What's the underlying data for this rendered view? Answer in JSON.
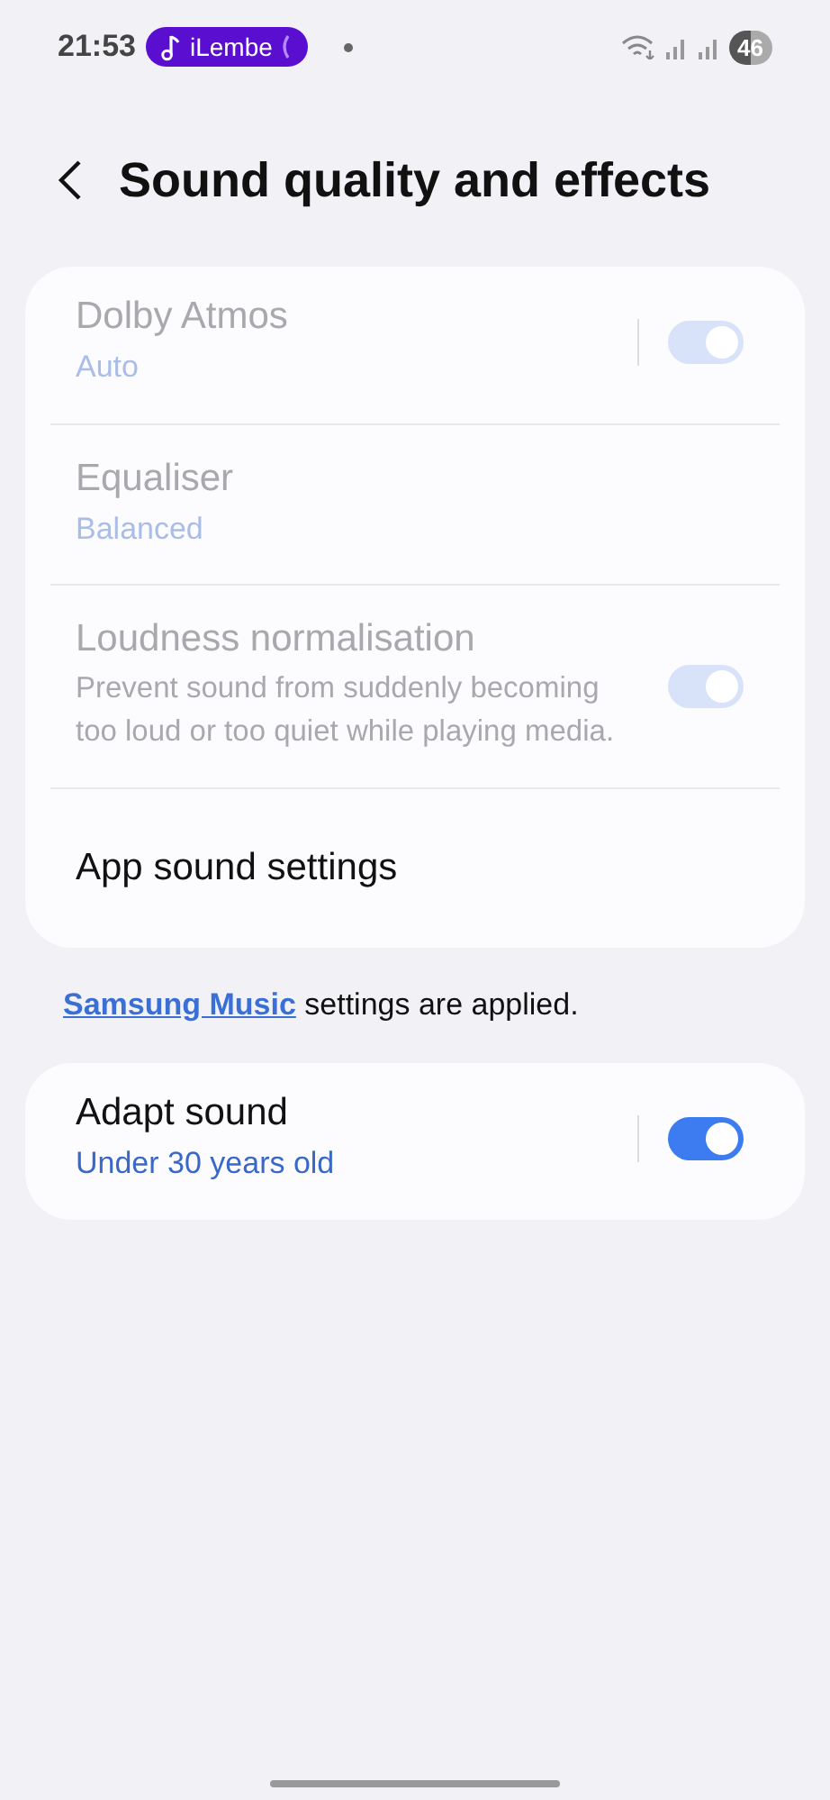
{
  "status_bar": {
    "time": "21:53",
    "media_pill": {
      "label": "iLembe"
    },
    "battery": "46"
  },
  "header": {
    "title": "Sound quality and effects"
  },
  "settings_card": {
    "items": [
      {
        "kind": "switch",
        "title": "Dolby Atmos",
        "value": "Auto",
        "disabled": true,
        "on": true,
        "divider": true
      },
      {
        "kind": "plain",
        "title": "Equaliser",
        "value": "Balanced",
        "disabled": true
      },
      {
        "kind": "switch",
        "title": "Loudness normalisation",
        "description": "Prevent sound from suddenly becoming too loud or too quiet while playing media.",
        "disabled": true,
        "on": true,
        "divider": false
      },
      {
        "kind": "plain",
        "title": "App sound settings",
        "disabled": false
      }
    ]
  },
  "note": {
    "link": "Samsung Music",
    "text": "settings are applied."
  },
  "adapt_card": {
    "items": [
      {
        "kind": "switch",
        "title": "Adapt sound",
        "value": "Under 30 years old",
        "disabled": false,
        "on": true,
        "divider": true
      }
    ]
  }
}
